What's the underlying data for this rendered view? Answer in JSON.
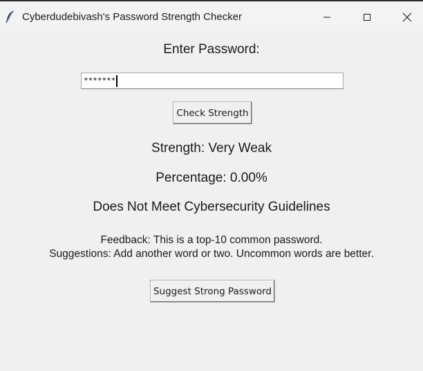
{
  "window": {
    "title": "Cyberdudebivash's Password Strength Checker",
    "icon": "feather-icon"
  },
  "form": {
    "prompt": "Enter Password:",
    "password_masked": "*******"
  },
  "buttons": {
    "check_label": "Check Strength",
    "suggest_label": "Suggest Strong Password"
  },
  "result": {
    "strength": "Strength: Very Weak",
    "percentage": "Percentage: 0.00%",
    "guideline": "Does Not Meet Cybersecurity Guidelines",
    "feedback": "Feedback: This is a top-10 common password.",
    "suggestions": "Suggestions: Add another word or two. Uncommon words are better."
  },
  "colors": {
    "background": "#f0f0f0",
    "text": "#1a1a1a"
  }
}
